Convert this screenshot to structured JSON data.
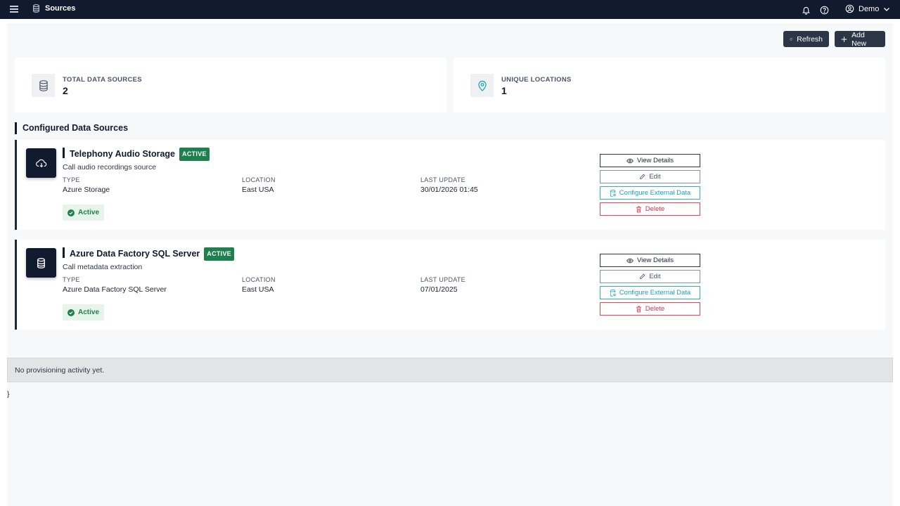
{
  "topbar": {
    "title": "Sources",
    "title_icon": "database-icon",
    "user_name": "Demo",
    "icons": [
      "menu-icon",
      "bell-icon",
      "help-icon",
      "user-circle-icon",
      "chevron-down-icon"
    ]
  },
  "toolbar": {
    "refresh_label": "Refresh",
    "add_new_label": "Add New"
  },
  "stats": [
    {
      "label": "TOTAL DATA SOURCES",
      "value": "2",
      "icon": "database-icon"
    },
    {
      "label": "UNIQUE LOCATIONS",
      "value": "1",
      "icon": "map-pin-icon"
    }
  ],
  "section_title": "Configured Data Sources",
  "sources": [
    {
      "name": "Telephony Audio Storage",
      "badge": "ACTIVE",
      "description": "Call audio recordings source",
      "icon": "cloud-download-icon",
      "type_label": "TYPE",
      "type": "Azure Storage",
      "location_label": "LOCATION",
      "location": "East USA",
      "last_update_label": "LAST UPDATE",
      "last_update": "30/01/2026 01:45",
      "status": "Active"
    },
    {
      "name": "Azure Data Factory SQL Server",
      "badge": "ACTIVE",
      "description": "Call metadata extraction",
      "icon": "database-icon",
      "type_label": "TYPE",
      "type": "Azure Data Factory SQL Server",
      "location_label": "LOCATION",
      "location": "East USA",
      "last_update_label": "LAST UPDATE",
      "last_update": "07/01/2025",
      "status": "Active"
    }
  ],
  "actions": {
    "view": "View Details",
    "edit": "Edit",
    "configure": "Configure External Data",
    "delete": "Delete"
  },
  "activity_message": "No provisioning activity yet.",
  "stray_text": "}",
  "colors": {
    "topbar": "#111a2e",
    "active_green": "#1e7f4f",
    "configure_cyan": "#1aa3b8",
    "delete_red": "#d63448"
  }
}
